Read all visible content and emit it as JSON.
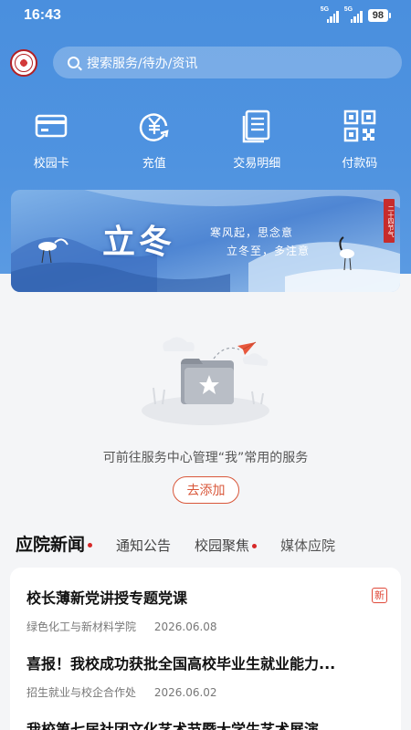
{
  "status_bar": {
    "time": "16:43",
    "sim1": "5G",
    "sim2": "5G",
    "battery": "98"
  },
  "search": {
    "placeholder": "搜索服务/待办/资讯"
  },
  "quick_actions": [
    {
      "label": "校园卡",
      "icon": "campus-card-icon"
    },
    {
      "label": "充值",
      "icon": "recharge-yen-icon"
    },
    {
      "label": "交易明细",
      "icon": "transaction-list-icon"
    },
    {
      "label": "付款码",
      "icon": "qr-code-icon"
    }
  ],
  "banner": {
    "title": "立冬",
    "line1": "寒风起，思念意",
    "line2": "立冬至，多注意",
    "seal": "二十四节气"
  },
  "empty_state": {
    "message": "可前往服务中心管理“我”常用的服务",
    "add_button": "去添加"
  },
  "news_tabs": [
    {
      "label": "应院新闻",
      "active": true,
      "dot": true
    },
    {
      "label": "通知公告",
      "active": false,
      "dot": false
    },
    {
      "label": "校园聚焦",
      "active": false,
      "dot": true
    },
    {
      "label": "媒体应院",
      "active": false,
      "dot": false
    }
  ],
  "news": [
    {
      "title": "校长薄新党讲授专题党课",
      "source": "绿色化工与新材料学院",
      "date": "2026.06.08",
      "badge": "新"
    },
    {
      "title": "喜报！我校成功获批全国高校毕业生就业能力...",
      "source": "招生就业与校企合作处",
      "date": "2026.06.02"
    },
    {
      "title": "我校第七届社团文化艺术节暨大学生艺术展演"
    }
  ],
  "colors": {
    "primary": "#4a8fde",
    "accent": "#d9573a",
    "dot": "#d62828"
  }
}
